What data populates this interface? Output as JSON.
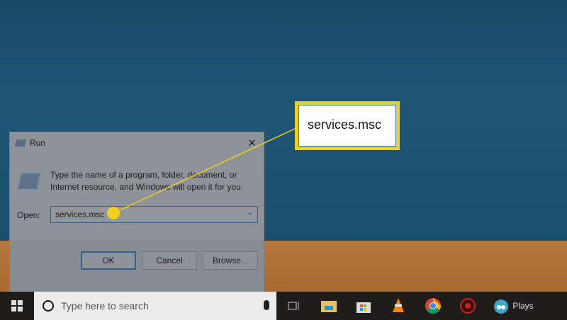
{
  "dialog": {
    "title": "Run",
    "close": "✕",
    "description": "Type the name of a program, folder, document, or Internet resource, and Windows will open it for you.",
    "open_label": "Open:",
    "open_value": "services.msc",
    "ok": "OK",
    "cancel": "Cancel",
    "browse": "Browse..."
  },
  "callout": {
    "text": "services.msc",
    "color": "#f2cf1a"
  },
  "taskbar": {
    "search_placeholder": "Type here to search",
    "plays_label": "Plays"
  }
}
